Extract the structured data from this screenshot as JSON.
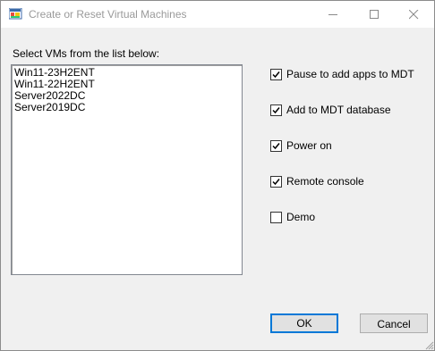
{
  "window": {
    "title": "Create or Reset Virtual Machines"
  },
  "list": {
    "label": "Select VMs from the list below:",
    "items": [
      "Win11-23H2ENT",
      "Win11-22H2ENT",
      "Server2022DC",
      "Server2019DC"
    ]
  },
  "options": [
    {
      "label": "Pause to add apps to MDT",
      "checked": true
    },
    {
      "label": "Add to MDT database",
      "checked": true
    },
    {
      "label": "Power on",
      "checked": true
    },
    {
      "label": "Remote console",
      "checked": true
    },
    {
      "label": "Demo",
      "checked": false
    }
  ],
  "buttons": {
    "ok": "OK",
    "cancel": "Cancel"
  },
  "colors": {
    "focus_border": "#0078d7",
    "title_text": "#9a9a9a"
  }
}
